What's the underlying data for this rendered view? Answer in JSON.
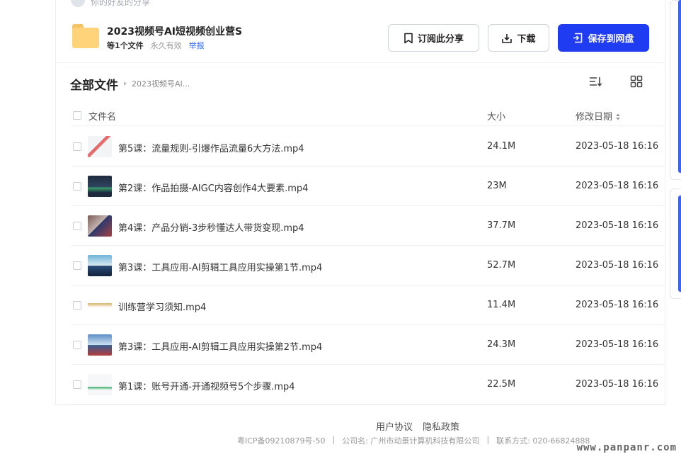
{
  "sharer": {
    "text": "你的好友的分享"
  },
  "share": {
    "title": "2023视频号AI短视频创业营S",
    "file_count": "等1个文件",
    "validity": "永久有效",
    "report": "举报"
  },
  "buttons": {
    "subscribe": "订阅此分享",
    "download": "下载",
    "save": "保存到网盘"
  },
  "breadcrumb": {
    "root": "全部文件",
    "current": "2023视频号AI..."
  },
  "table": {
    "headers": {
      "name": "文件名",
      "size": "大小",
      "date": "修改日期"
    },
    "rows": [
      {
        "name": "第5课：流量规则-引爆作品流量6大方法.mp4",
        "size": "24.1M",
        "date": "2023-05-18 16:16"
      },
      {
        "name": "第2课：作品拍摄-AIGC内容创作4大要素.mp4",
        "size": "23M",
        "date": "2023-05-18 16:16"
      },
      {
        "name": "第4课：产品分销-3步秒懂达人带货变现.mp4",
        "size": "37.7M",
        "date": "2023-05-18 16:16"
      },
      {
        "name": "第3课：工具应用-AI剪辑工具应用实操第1节.mp4",
        "size": "52.7M",
        "date": "2023-05-18 16:16"
      },
      {
        "name": "训练营学习须知.mp4",
        "size": "11.4M",
        "date": "2023-05-18 16:16"
      },
      {
        "name": "第3课：工具应用-AI剪辑工具应用实操第2节.mp4",
        "size": "24.3M",
        "date": "2023-05-18 16:16"
      },
      {
        "name": "第1课：账号开通-开通视频号5个步骤.mp4",
        "size": "22.5M",
        "date": "2023-05-18 16:16"
      }
    ]
  },
  "footer": {
    "links": [
      "用户协议",
      "隐私政策"
    ],
    "icp": "粤ICP备09210879号-50",
    "company": "公司名: 广州市动景计算机科技有限公司",
    "contact": "联系方式: 020-66824888",
    "sep": "|"
  },
  "watermark": "www.panpanr.com",
  "colors": {
    "primary": "#1f3cf2",
    "link": "#3a6ef3",
    "folder": "#ffd37a"
  },
  "icons": [
    "bookmark-icon",
    "download-icon",
    "save-icon",
    "sort-list-icon",
    "grid-view-icon",
    "folder-icon",
    "sort-icon"
  ]
}
